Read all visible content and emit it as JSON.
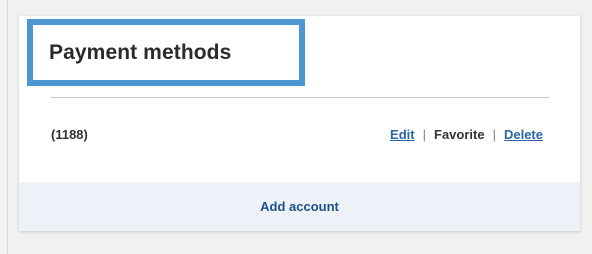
{
  "card": {
    "title": "Payment methods",
    "accounts": [
      {
        "label": "(1188)",
        "actions": {
          "edit": "Edit",
          "favorite": "Favorite",
          "delete": "Delete",
          "separator": "|"
        }
      }
    ],
    "footer": {
      "add_account": "Add account"
    }
  },
  "colors": {
    "highlight_border": "#4d97d1",
    "link": "#2b64a8",
    "footer_bg": "#edf2f8",
    "footer_link": "#1f4f89"
  }
}
